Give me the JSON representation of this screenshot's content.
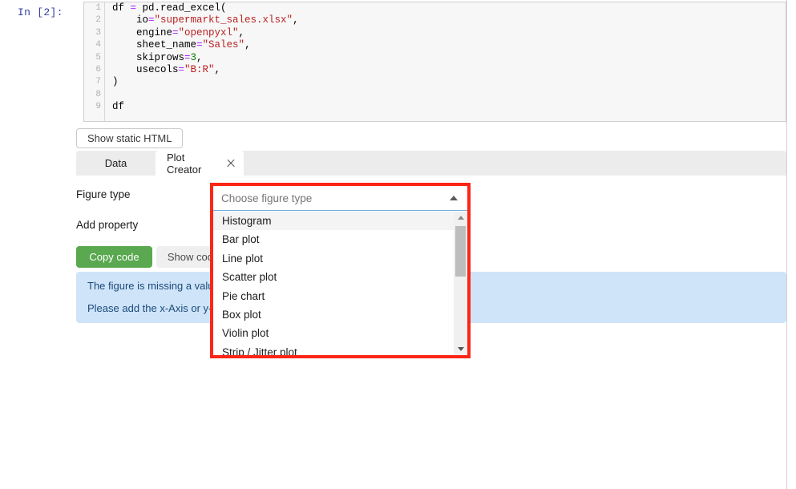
{
  "notebook": {
    "prompt": "In  [2]:",
    "code_lines": [
      {
        "n": "1",
        "segments": [
          {
            "t": "df ",
            "c": "plain"
          },
          {
            "t": "=",
            "c": "op"
          },
          {
            "t": " pd.read_excel(",
            "c": "plain"
          }
        ]
      },
      {
        "n": "2",
        "segments": [
          {
            "t": "    io",
            "c": "plain"
          },
          {
            "t": "=",
            "c": "op"
          },
          {
            "t": "\"supermarkt_sales.xlsx\"",
            "c": "str"
          },
          {
            "t": ",",
            "c": "plain"
          }
        ]
      },
      {
        "n": "3",
        "segments": [
          {
            "t": "    engine",
            "c": "plain"
          },
          {
            "t": "=",
            "c": "op"
          },
          {
            "t": "\"openpyxl\"",
            "c": "str"
          },
          {
            "t": ",",
            "c": "plain"
          }
        ]
      },
      {
        "n": "4",
        "segments": [
          {
            "t": "    sheet_name",
            "c": "plain"
          },
          {
            "t": "=",
            "c": "op"
          },
          {
            "t": "\"Sales\"",
            "c": "str"
          },
          {
            "t": ",",
            "c": "plain"
          }
        ]
      },
      {
        "n": "5",
        "segments": [
          {
            "t": "    skiprows",
            "c": "plain"
          },
          {
            "t": "=",
            "c": "op"
          },
          {
            "t": "3",
            "c": "num"
          },
          {
            "t": ",",
            "c": "plain"
          }
        ]
      },
      {
        "n": "6",
        "segments": [
          {
            "t": "    usecols",
            "c": "plain"
          },
          {
            "t": "=",
            "c": "op"
          },
          {
            "t": "\"B:R\"",
            "c": "str"
          },
          {
            "t": ",",
            "c": "plain"
          }
        ]
      },
      {
        "n": "7",
        "segments": [
          {
            "t": ")",
            "c": "plain"
          }
        ]
      },
      {
        "n": "8",
        "segments": [
          {
            "t": "",
            "c": "plain"
          }
        ]
      },
      {
        "n": "9",
        "segments": [
          {
            "t": "df",
            "c": "plain"
          }
        ]
      }
    ]
  },
  "widget": {
    "static_html_button": "Show static HTML",
    "tabs": [
      {
        "label": "Data",
        "active": false,
        "closable": false
      },
      {
        "label": "Plot Creator",
        "active": true,
        "closable": true
      }
    ],
    "labels": {
      "figure_type": "Figure type",
      "add_property": "Add property"
    },
    "buttons": {
      "copy_code": "Copy code",
      "show_code": "Show code"
    },
    "info_messages": [
      "The figure is missing a value for the x-Axis or the y-Axis.",
      "Please add the x-Axis or y-Axis property to the figure."
    ],
    "figure_type_select": {
      "placeholder": "Choose figure type",
      "value": "",
      "expanded": true,
      "highlight_color": "#fb2616",
      "options": [
        "Histogram",
        "Bar plot",
        "Line plot",
        "Scatter plot",
        "Pie chart",
        "Box plot",
        "Violin plot",
        "Strip / Jitter plot"
      ],
      "hovered_option": "Histogram"
    }
  },
  "colors": {
    "accent_green": "#5aa84f",
    "info_bg": "#cfe4f8",
    "info_text": "#1a4a7a",
    "highlight_red": "#fb2616",
    "prompt_blue": "#303F9F"
  }
}
